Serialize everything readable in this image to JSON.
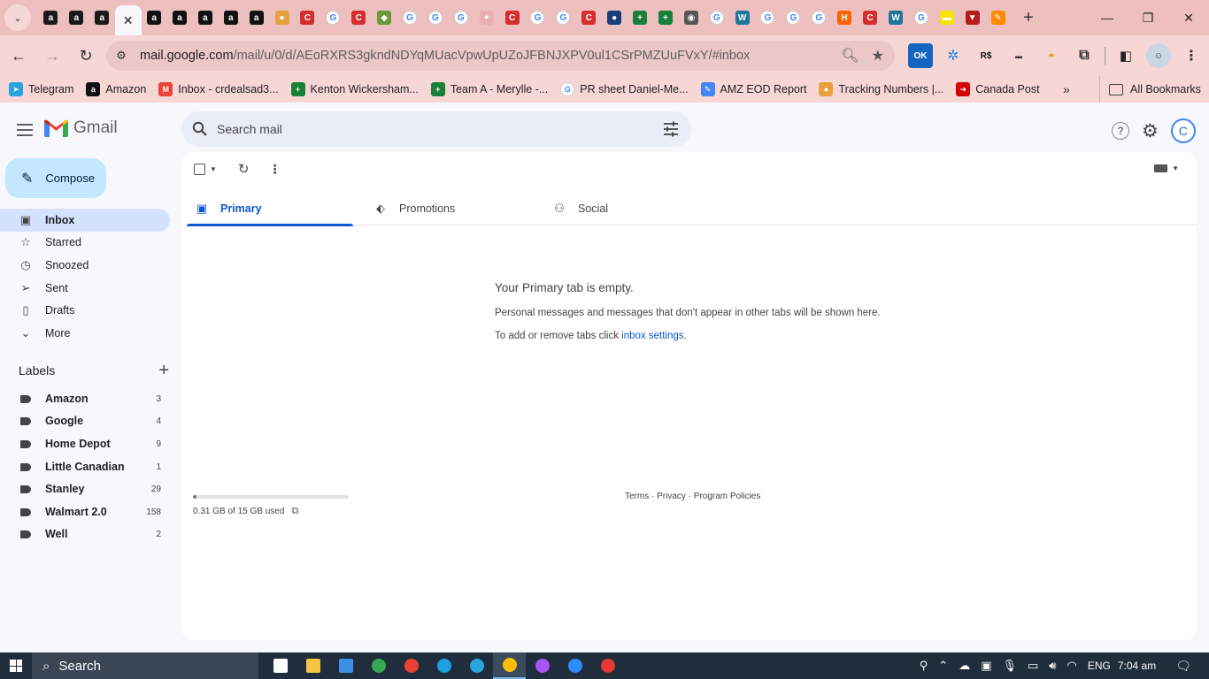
{
  "browser": {
    "tabs": [
      {
        "icon": "amazon-icon",
        "color": "#1a1a1a",
        "glyph": "a"
      },
      {
        "icon": "amazon-icon",
        "color": "#1a1a1a",
        "glyph": "a"
      },
      {
        "icon": "amazon-icon",
        "color": "#1a1a1a",
        "glyph": "a"
      },
      {
        "icon": "active",
        "color": "#f6f8fc",
        "glyph": "✕"
      },
      {
        "icon": "amazon-icon",
        "color": "#111111",
        "glyph": "a"
      },
      {
        "icon": "amazon-icon",
        "color": "#111111",
        "glyph": "a"
      },
      {
        "icon": "amazon-icon",
        "color": "#111111",
        "glyph": "a"
      },
      {
        "icon": "amazon-icon",
        "color": "#111111",
        "glyph": "a"
      },
      {
        "icon": "amazon-icon",
        "color": "#111111",
        "glyph": "a"
      },
      {
        "icon": "taco-icon",
        "color": "#e6a23c",
        "glyph": "●"
      },
      {
        "icon": "red-c-icon",
        "color": "#d32f2f",
        "glyph": "C"
      },
      {
        "icon": "google-icon",
        "color": "#ffffff",
        "glyph": "G"
      },
      {
        "icon": "red-c-icon",
        "color": "#d32f2f",
        "glyph": "C"
      },
      {
        "icon": "leaf-icon",
        "color": "#6a9a3a",
        "glyph": "◆"
      },
      {
        "icon": "google-icon",
        "color": "#ffffff",
        "glyph": "G"
      },
      {
        "icon": "google-icon",
        "color": "#ffffff",
        "glyph": "G"
      },
      {
        "icon": "google-icon",
        "color": "#ffffff",
        "glyph": "G"
      },
      {
        "icon": "star-icon",
        "color": "#e8b0b0",
        "glyph": "✦"
      },
      {
        "icon": "red-c-icon",
        "color": "#d32f2f",
        "glyph": "C"
      },
      {
        "icon": "google-icon",
        "color": "#ffffff",
        "glyph": "G"
      },
      {
        "icon": "google-icon",
        "color": "#ffffff",
        "glyph": "G"
      },
      {
        "icon": "red-c-icon",
        "color": "#d32f2f",
        "glyph": "C"
      },
      {
        "icon": "blue-dot-icon",
        "color": "#1a3c7a",
        "glyph": "●"
      },
      {
        "icon": "sheets-icon",
        "color": "#188038",
        "glyph": "+"
      },
      {
        "icon": "sheets-icon",
        "color": "#188038",
        "glyph": "+"
      },
      {
        "icon": "chrome-icon",
        "color": "#555555",
        "glyph": "◉"
      },
      {
        "icon": "google-icon",
        "color": "#ffffff",
        "glyph": "G"
      },
      {
        "icon": "wordpress-icon",
        "color": "#21759b",
        "glyph": "W"
      },
      {
        "icon": "google-icon",
        "color": "#ffffff",
        "glyph": "G"
      },
      {
        "icon": "google-icon",
        "color": "#ffffff",
        "glyph": "G"
      },
      {
        "icon": "google-icon",
        "color": "#ffffff",
        "glyph": "G"
      },
      {
        "icon": "homedepot-icon",
        "color": "#f96302",
        "glyph": "H"
      },
      {
        "icon": "red-c-icon",
        "color": "#d32f2f",
        "glyph": "C"
      },
      {
        "icon": "wordpress-icon",
        "color": "#21759b",
        "glyph": "W"
      },
      {
        "icon": "google-icon",
        "color": "#ffffff",
        "glyph": "G"
      },
      {
        "icon": "yellow-icon",
        "color": "#f5e400",
        "glyph": "▬"
      },
      {
        "icon": "red-v-icon",
        "color": "#b71c1c",
        "glyph": "▼"
      },
      {
        "icon": "multicolor-icon",
        "color": "#ff8a00",
        "glyph": "✎"
      }
    ],
    "url_host": "mail.google.com",
    "url_path": "/mail/u/0/d/AEoRXRS3gkndNDYqMUacVpwUpUZoJFBNJXPV0ul1CSrPMZUuFVxY/#inbox",
    "bookmarks": [
      {
        "label": "Telegram",
        "icon": "telegram-icon",
        "color": "#2aa3df",
        "glyph": "➤"
      },
      {
        "label": "Amazon",
        "icon": "amazon-icon",
        "color": "#111111",
        "glyph": "a"
      },
      {
        "label": "Inbox - crdealsad3...",
        "icon": "gmail-icon",
        "color": "#ea4335",
        "glyph": "M"
      },
      {
        "label": "Kenton Wickersham...",
        "icon": "sheets-icon",
        "color": "#188038",
        "glyph": "+"
      },
      {
        "label": "Team A - Merylle -...",
        "icon": "sheets-icon",
        "color": "#188038",
        "glyph": "+"
      },
      {
        "label": "PR sheet Daniel-Me...",
        "icon": "google-icon",
        "color": "#ffffff",
        "glyph": "G"
      },
      {
        "label": "AMZ EOD Report",
        "icon": "multicolor-icon",
        "color": "#4285f4",
        "glyph": "✎"
      },
      {
        "label": "Tracking Numbers |...",
        "icon": "taco-icon",
        "color": "#e6a23c",
        "glyph": "●"
      },
      {
        "label": "Canada Post",
        "icon": "canadapost-icon",
        "color": "#d50000",
        "glyph": "➜"
      }
    ],
    "all_bookmarks": "All Bookmarks"
  },
  "gmail": {
    "app_name": "Gmail",
    "search_placeholder": "Search mail",
    "avatar_letter": "C",
    "compose": "Compose",
    "nav": [
      {
        "label": "Inbox",
        "icon": "inbox-icon",
        "glyph": "▣",
        "active": true
      },
      {
        "label": "Starred",
        "icon": "star-icon",
        "glyph": "☆",
        "active": false
      },
      {
        "label": "Snoozed",
        "icon": "clock-icon",
        "glyph": "◷",
        "active": false
      },
      {
        "label": "Sent",
        "icon": "send-icon",
        "glyph": "➢",
        "active": false
      },
      {
        "label": "Drafts",
        "icon": "draft-icon",
        "glyph": "▯",
        "active": false
      },
      {
        "label": "More",
        "icon": "chevron-down-icon",
        "glyph": "⌄",
        "active": false
      }
    ],
    "labels_title": "Labels",
    "labels": [
      {
        "name": "Amazon",
        "count": "3"
      },
      {
        "name": "Google",
        "count": "4"
      },
      {
        "name": "Home Depot",
        "count": "9"
      },
      {
        "name": "Little Canadian",
        "count": "1"
      },
      {
        "name": "Stanley",
        "count": "29"
      },
      {
        "name": "Walmart 2.0",
        "count": "158"
      },
      {
        "name": "Well",
        "count": "2"
      }
    ],
    "category_tabs": [
      {
        "label": "Primary",
        "icon": "inbox-icon",
        "glyph": "▣",
        "active": true
      },
      {
        "label": "Promotions",
        "icon": "tag-icon",
        "glyph": "⬖",
        "active": false
      },
      {
        "label": "Social",
        "icon": "people-icon",
        "glyph": "⚇",
        "active": false
      }
    ],
    "empty_title": "Your Primary tab is empty.",
    "empty_desc": "Personal messages and messages that don't appear in other tabs will be shown here.",
    "empty_hint_prefix": "To add or remove tabs click ",
    "empty_hint_link": "inbox settings",
    "empty_hint_suffix": ".",
    "storage_text": "0.31 GB of 15 GB used",
    "storage_fraction": 0.021,
    "footer": "Terms · Privacy · Program Policies"
  },
  "taskbar": {
    "search_label": "Search",
    "language": "ENG",
    "time": "7:04 am",
    "apps": [
      {
        "icon": "task-view-icon",
        "color": "#ffffff"
      },
      {
        "icon": "file-explorer-icon",
        "color": "#f4c542"
      },
      {
        "icon": "mail-icon",
        "color": "#3d8ee6"
      },
      {
        "icon": "chrome-icon",
        "color": "#34a853"
      },
      {
        "icon": "chrome-icon",
        "color": "#ea4335"
      },
      {
        "icon": "edge-icon",
        "color": "#1ba1e2"
      },
      {
        "icon": "telegram-icon",
        "color": "#2aa3df"
      },
      {
        "icon": "chrome-icon",
        "color": "#fbbc04"
      },
      {
        "icon": "messenger-icon",
        "color": "#a855f7"
      },
      {
        "icon": "zoom-icon",
        "color": "#2d8cff"
      },
      {
        "icon": "app-icon",
        "color": "#e53935"
      }
    ],
    "active_app_index": 7
  }
}
